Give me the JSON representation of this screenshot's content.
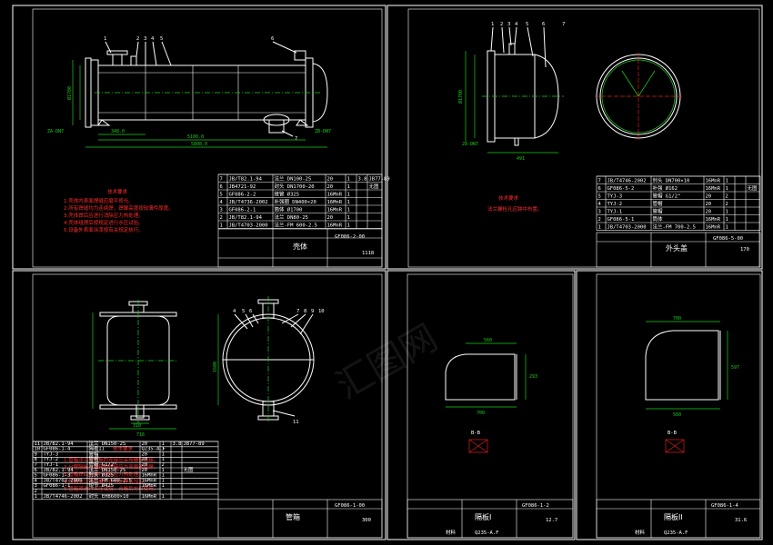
{
  "sheet1": {
    "balloons": [
      "1",
      "2",
      "3",
      "4",
      "5",
      "6",
      "7"
    ],
    "dims": {
      "d348": "348.0",
      "d5100": "5100.0",
      "d5808": "5808.0",
      "nozzle_left": "ZA-DN7",
      "nozzle_right": "ZB-DN7",
      "d1700": "Ø1700"
    },
    "notes_title": "技术要求",
    "notes": [
      "1.壳体内表面焊缝应磨平修光。",
      "2.所有焊缝均为连续焊，焊脚高度按较薄件厚度。",
      "3.壳体焊后应进行消除应力热处理。",
      "4.壳体组焊后按规定进行水压试验。",
      "5.设备外表面涂漆按有关规定执行。"
    ],
    "bom": [
      [
        "7",
        "JB/T82.1-94",
        "法兰 DN100-25",
        "20",
        "1",
        "3.8",
        "JB77-89"
      ],
      [
        "6",
        "JB4721-92",
        "封头 DN1700-20",
        "20",
        "1",
        "",
        "无图"
      ],
      [
        "5",
        "GF086-2-2",
        "接管 Ø325",
        "16MnR",
        "1",
        "",
        ""
      ],
      [
        "4",
        "JB/T4736-2002",
        "补强圈 DN400×20",
        "16MnR",
        "1",
        "",
        ""
      ],
      [
        "3",
        "GF086-2-1",
        "筒体 Ø1700",
        "16MnR",
        "1",
        "",
        ""
      ],
      [
        "2",
        "JB/T82.1-94",
        "法兰 DN80-25",
        "20",
        "1",
        "",
        ""
      ],
      [
        "1",
        "JB/T4703-2000",
        "法兰-FM 600-2.5",
        "16MnR",
        "1",
        "",
        ""
      ]
    ],
    "code": "GF086-2-00",
    "title": "壳体",
    "mass": "1118"
  },
  "sheet2": {
    "balloons": [
      "1",
      "2",
      "3",
      "4",
      "5",
      "6",
      "7"
    ],
    "dims": {
      "d491": "491",
      "d1700": "Ø1700",
      "d28": "28-DN7"
    },
    "notes_title": "技术要求",
    "notes": [
      "法兰螺栓孔应跨中布置。"
    ],
    "bom": [
      [
        "7",
        "JB/T4746-2002",
        "封头 DN700×10",
        "16MnR",
        "1",
        "",
        ""
      ],
      [
        "6",
        "GF086-5-2",
        "补强 Ø162",
        "16MnR",
        "1",
        "",
        "无图"
      ],
      [
        "5",
        "TYJ-3",
        "管帽 G1/2\"",
        "20",
        "2",
        "",
        ""
      ],
      [
        "4",
        "TYJ-2",
        "管帽",
        "20",
        "2",
        "",
        ""
      ],
      [
        "3",
        "TYJ-1",
        "管帽",
        "20",
        "1",
        "",
        ""
      ],
      [
        "2",
        "GF086-5-1",
        "筒体",
        "16MnR",
        "1",
        "",
        ""
      ],
      [
        "1",
        "JB/T4703-2000",
        "法兰-FM 700-2.5",
        "16MnR",
        "1",
        "",
        ""
      ]
    ],
    "code": "GF086-5-00",
    "title": "外头盖",
    "mass": "170"
  },
  "sheet3": {
    "balloons": [
      "4",
      "5",
      "6",
      "7",
      "8",
      "9",
      "10",
      "11"
    ],
    "dims": {
      "d310": "310",
      "d716": "716",
      "d1600": "1600"
    },
    "notes_title": "技术要求",
    "notes": [
      "1.管箱法兰与管板的连接应采用螺栓连接。",
      "2.分程隔板与管箱的焊接应为双面连续焊。",
      "3.管箱焊后应进行消除应力热处理。",
      "4.管箱法兰密封面应在热处理后加工。",
      "5.管箱须进行水压试验，合格后方可使用。"
    ],
    "bom": [
      [
        "11",
        "JB/82.1-94",
        "法兰 DN150-25",
        "20",
        "1",
        "3.8",
        "JB77-89"
      ],
      [
        "10",
        "GF086-1-4",
        "隔板II",
        "Q235-A.F",
        "1",
        "",
        ""
      ],
      [
        "9",
        "TYJ-3",
        "管帽",
        "20",
        "1",
        "",
        ""
      ],
      [
        "8",
        "TYJ-2",
        "管帽",
        "20",
        "1",
        "",
        ""
      ],
      [
        "7",
        "TYJ-1",
        "管帽 G1/2\"",
        "20",
        "2",
        "",
        ""
      ],
      [
        "6",
        "JB/82.1-94",
        "法兰 DN150-25",
        "20",
        "1",
        "",
        "无图"
      ],
      [
        "5",
        "GF086-1-3",
        "封头 Ø325",
        "16MnR",
        "1",
        "",
        ""
      ],
      [
        "4",
        "JB/T4703-2000",
        "法兰-FM 600-2.5",
        "16MnR",
        "1",
        "",
        ""
      ],
      [
        "3",
        "GF086-1-1",
        "短节 Ø425",
        "16MnR",
        "1",
        "",
        ""
      ],
      [
        "2",
        "",
        "",
        "",
        "",
        "",
        ""
      ],
      [
        "1",
        "JB/T4746-2002",
        "封头 EHB600×10",
        "16MnR",
        "1",
        "",
        ""
      ]
    ],
    "code": "GF086-1-00",
    "title": "管箱",
    "mass": "300"
  },
  "sheet4": {
    "dims": {
      "d560": "560",
      "d700": "700",
      "d293": "293"
    },
    "section": "B-B",
    "code": "GF086-1-2",
    "title": "隔板I",
    "material": "Q235-A.F",
    "mass": "12.7",
    "material_label": "材料"
  },
  "sheet5": {
    "dims": {
      "d700": "700",
      "d560": "560",
      "d597": "597"
    },
    "section": "B-B",
    "code": "GF086-1-4",
    "title": "隔板II",
    "material": "Q235-A.F",
    "mass": "31.6",
    "material_label": "材料"
  },
  "watermark": "汇图网"
}
